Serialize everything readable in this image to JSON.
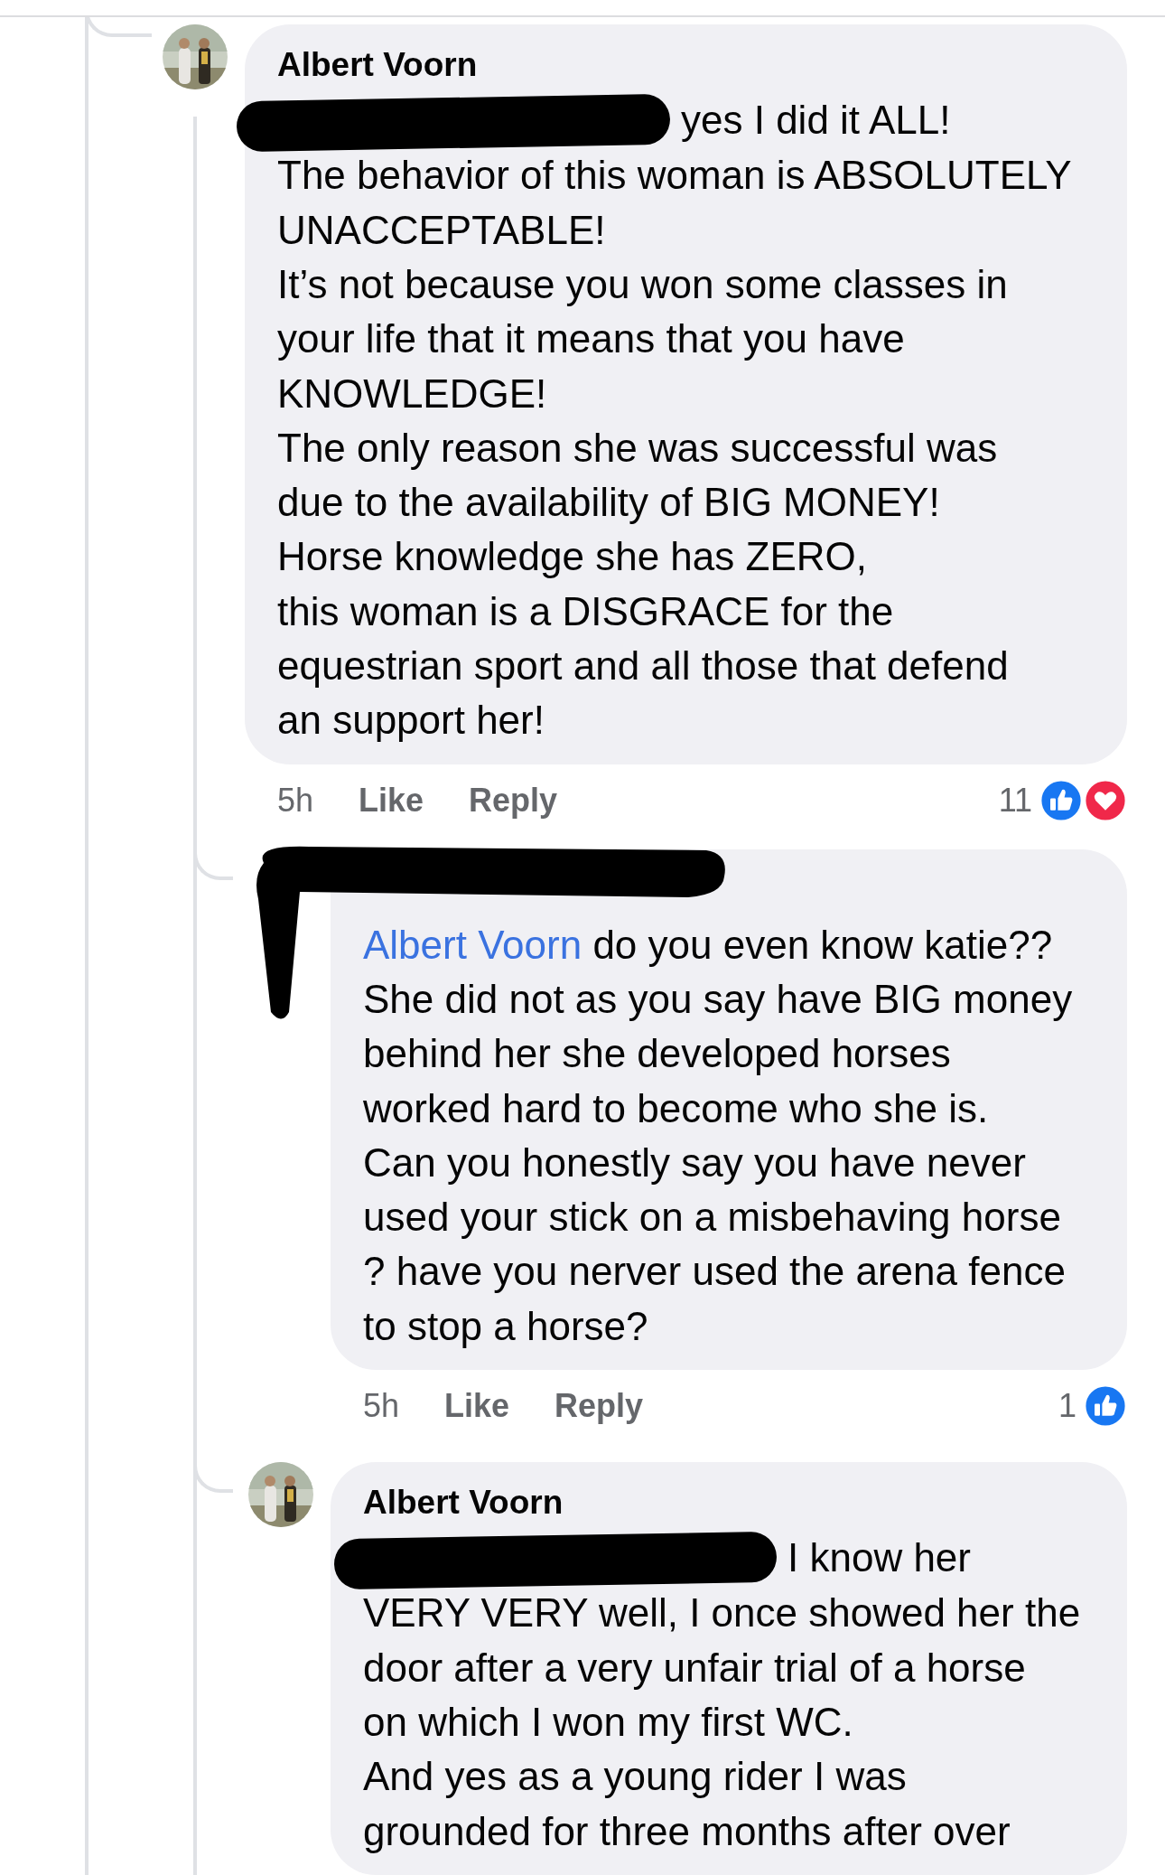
{
  "comments": [
    {
      "name": "Albert Voorn",
      "avatar": {
        "kind": "picture"
      },
      "mention_redacted": true,
      "kind": "comment",
      "lines": [
        "yes I did it ALL!",
        "The behavior of this woman is ABSOLUTELY",
        "UNACCEPTABLE!",
        "It’s not because you won some classes in",
        "your life that it means that you have",
        "KNOWLEDGE!",
        "The only reason she was successful was",
        "due to the availability of BIG MONEY!",
        "Horse knowledge she has ZERO,",
        "this woman is a DISGRACE for the",
        "equestrian sport and all those that defend",
        "an support her!"
      ],
      "time": "5h",
      "like": "Like",
      "reply": "Reply",
      "reaction_count": "11",
      "reactions": [
        {
          "kind": "like"
        },
        {
          "kind": "love"
        }
      ]
    },
    {
      "author_redacted": true,
      "mention": "Albert Voorn",
      "kind": "reply",
      "lines": [
        " do you even know katie??",
        "She did not as you say have BIG money",
        "behind her she developed horses",
        "worked hard to become who she is.",
        "Can you honestly say you have never",
        "used your stick on a misbehaving horse",
        "? have you nerver used the arena fence",
        "to stop a horse?"
      ],
      "time": "5h",
      "like": "Like",
      "reply": "Reply",
      "reaction_count": "1",
      "reactions": [
        {
          "kind": "like"
        }
      ]
    },
    {
      "name": "Albert Voorn",
      "avatar": {
        "kind": "picture"
      },
      "mention_redacted": true,
      "kind": "reply",
      "lines": [
        "I know her",
        "VERY VERY well, I once showed her the",
        "door after a very unfair trial of a horse",
        "on which I won my first WC.",
        "And yes as a young rider I was",
        "grounded for three months after over"
      ]
    }
  ]
}
